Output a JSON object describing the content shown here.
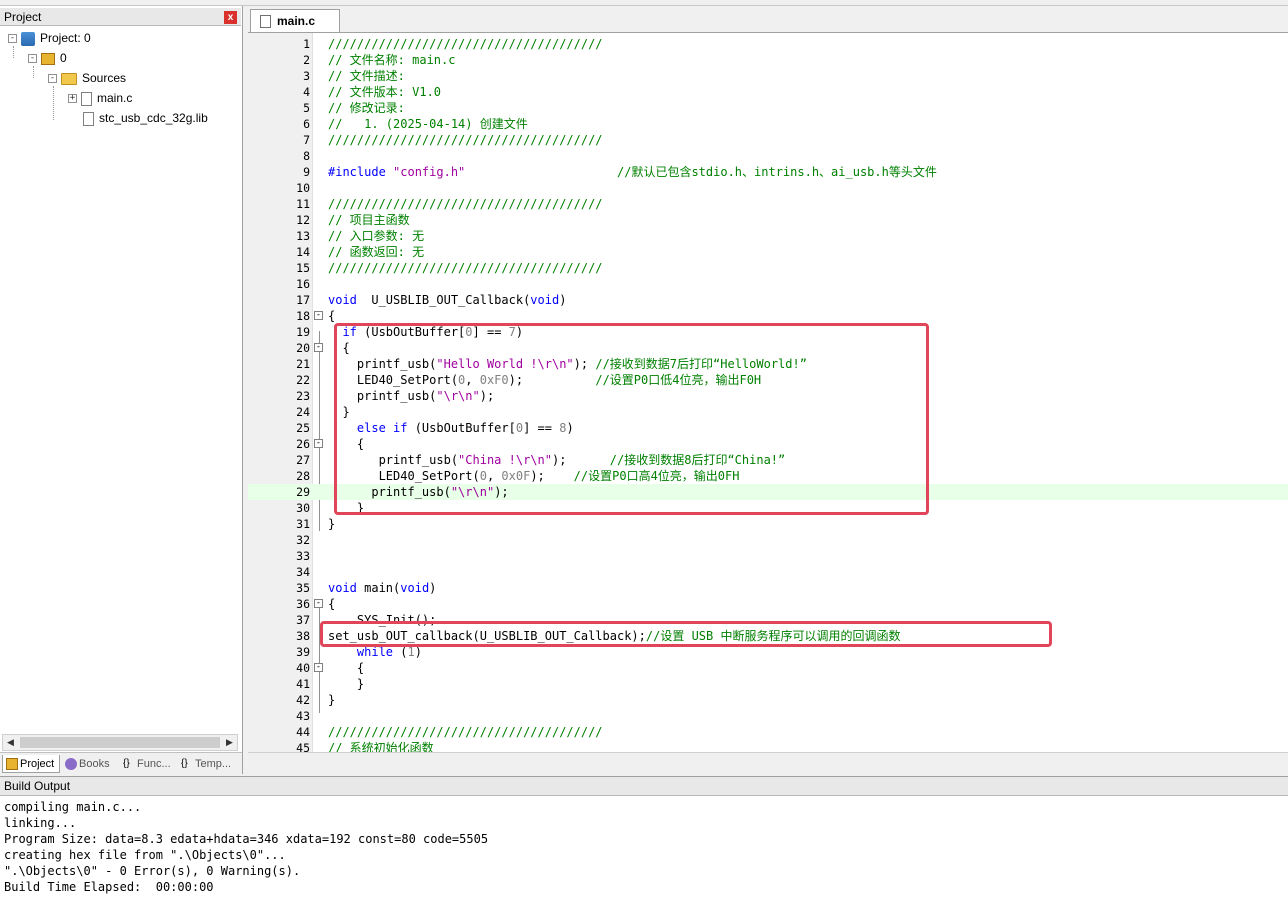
{
  "project_panel": {
    "title": "Project",
    "pin_glyph": "\u0004",
    "close_glyph": "x",
    "tree": {
      "root": "Project: 0",
      "target": "0",
      "group": "Sources",
      "files": [
        "main.c",
        "stc_usb_cdc_32g.lib"
      ]
    },
    "tabs": [
      "Project",
      "Books",
      "Func...",
      "Temp..."
    ]
  },
  "editor": {
    "tab_label": "main.c",
    "lines": [
      {
        "n": "1",
        "parts": [
          [
            "c",
            "//////////////////////////////////////"
          ]
        ]
      },
      {
        "n": "2",
        "parts": [
          [
            "c",
            "// 文件名称: main.c"
          ]
        ]
      },
      {
        "n": "3",
        "parts": [
          [
            "c",
            "// 文件描述:"
          ]
        ]
      },
      {
        "n": "4",
        "parts": [
          [
            "c",
            "// 文件版本: V1.0"
          ]
        ]
      },
      {
        "n": "5",
        "parts": [
          [
            "c",
            "// 修改记录:"
          ]
        ]
      },
      {
        "n": "6",
        "parts": [
          [
            "c",
            "//   1. (2025-04-14) 创建文件"
          ]
        ]
      },
      {
        "n": "7",
        "parts": [
          [
            "c",
            "//////////////////////////////////////"
          ]
        ]
      },
      {
        "n": "8",
        "parts": []
      },
      {
        "n": "9",
        "parts": [
          [
            "k",
            "#include "
          ],
          [
            "s",
            "\"config.h\""
          ],
          [
            "p",
            "                     "
          ],
          [
            "c",
            "//默认已包含stdio.h、intrins.h、ai_usb.h等头文件"
          ]
        ]
      },
      {
        "n": "10",
        "parts": []
      },
      {
        "n": "11",
        "parts": [
          [
            "c",
            "//////////////////////////////////////"
          ]
        ]
      },
      {
        "n": "12",
        "parts": [
          [
            "c",
            "// 项目主函数"
          ]
        ]
      },
      {
        "n": "13",
        "parts": [
          [
            "c",
            "// 入口参数: 无"
          ]
        ]
      },
      {
        "n": "14",
        "parts": [
          [
            "c",
            "// 函数返回: 无"
          ]
        ]
      },
      {
        "n": "15",
        "parts": [
          [
            "c",
            "//////////////////////////////////////"
          ]
        ]
      },
      {
        "n": "16",
        "parts": []
      },
      {
        "n": "17",
        "parts": [
          [
            "k",
            "void"
          ],
          [
            "p",
            "  U_USBLIB_OUT_Callback("
          ],
          [
            "k",
            "void"
          ],
          [
            "p",
            ")"
          ]
        ]
      },
      {
        "n": "18",
        "parts": [
          [
            "p",
            "{"
          ]
        ],
        "fold": "-"
      },
      {
        "n": "19",
        "parts": [
          [
            "p",
            "  "
          ],
          [
            "k",
            "if"
          ],
          [
            "p",
            " (UsbOutBuffer["
          ],
          [
            "n",
            "0"
          ],
          [
            "p",
            "] == "
          ],
          [
            "n",
            "7"
          ],
          [
            "p",
            ")"
          ]
        ]
      },
      {
        "n": "20",
        "parts": [
          [
            "p",
            "  {"
          ]
        ],
        "fold": "-"
      },
      {
        "n": "21",
        "parts": [
          [
            "p",
            "    printf_usb("
          ],
          [
            "s",
            "\"Hello World !\\r\\n\""
          ],
          [
            "p",
            "); "
          ],
          [
            "c",
            "//接收到数据7后打印“HelloWorld!”"
          ]
        ]
      },
      {
        "n": "22",
        "parts": [
          [
            "p",
            "    LED40_SetPort("
          ],
          [
            "n",
            "0"
          ],
          [
            "p",
            ", "
          ],
          [
            "n",
            "0xF0"
          ],
          [
            "p",
            ");          "
          ],
          [
            "c",
            "//设置P0口低4位亮，输出F0H"
          ]
        ]
      },
      {
        "n": "23",
        "parts": [
          [
            "p",
            "    printf_usb("
          ],
          [
            "s",
            "\"\\r\\n\""
          ],
          [
            "p",
            ");"
          ]
        ]
      },
      {
        "n": "24",
        "parts": [
          [
            "p",
            "  }"
          ]
        ]
      },
      {
        "n": "25",
        "parts": [
          [
            "p",
            "    "
          ],
          [
            "k",
            "else if"
          ],
          [
            "p",
            " (UsbOutBuffer["
          ],
          [
            "n",
            "0"
          ],
          [
            "p",
            "] == "
          ],
          [
            "n",
            "8"
          ],
          [
            "p",
            ")"
          ]
        ]
      },
      {
        "n": "26",
        "parts": [
          [
            "p",
            "    {"
          ]
        ],
        "fold": "-"
      },
      {
        "n": "27",
        "parts": [
          [
            "p",
            "       printf_usb("
          ],
          [
            "s",
            "\"China !\\r\\n\""
          ],
          [
            "p",
            ");      "
          ],
          [
            "c",
            "//接收到数据8后打印“China!”"
          ]
        ]
      },
      {
        "n": "28",
        "parts": [
          [
            "p",
            "       LED40_SetPort("
          ],
          [
            "n",
            "0"
          ],
          [
            "p",
            ", "
          ],
          [
            "n",
            "0x0F"
          ],
          [
            "p",
            ");    "
          ],
          [
            "c",
            "//设置P0口高4位亮，输出0FH"
          ]
        ]
      },
      {
        "n": "29",
        "parts": [
          [
            "p",
            "      printf_usb("
          ],
          [
            "s",
            "\"\\r\\n\""
          ],
          [
            "p",
            ");"
          ]
        ],
        "highlight": true
      },
      {
        "n": "30",
        "parts": [
          [
            "p",
            "    }"
          ]
        ]
      },
      {
        "n": "31",
        "parts": [
          [
            "p",
            "}"
          ]
        ]
      },
      {
        "n": "32",
        "parts": []
      },
      {
        "n": "33",
        "parts": []
      },
      {
        "n": "34",
        "parts": []
      },
      {
        "n": "35",
        "parts": [
          [
            "k",
            "void"
          ],
          [
            "p",
            " main("
          ],
          [
            "k",
            "void"
          ],
          [
            "p",
            ")"
          ]
        ]
      },
      {
        "n": "36",
        "parts": [
          [
            "p",
            "{"
          ]
        ],
        "fold": "-"
      },
      {
        "n": "37",
        "parts": [
          [
            "p",
            "    SYS_Init();"
          ]
        ]
      },
      {
        "n": "38",
        "parts": [
          [
            "p",
            "set_usb_OUT_callback(U_USBLIB_OUT_Callback);"
          ],
          [
            "c",
            "//设置 USB 中断服务程序可以调用的回调函数"
          ]
        ]
      },
      {
        "n": "39",
        "parts": [
          [
            "p",
            "    "
          ],
          [
            "k",
            "while"
          ],
          [
            "p",
            " ("
          ],
          [
            "n",
            "1"
          ],
          [
            "p",
            ")"
          ]
        ]
      },
      {
        "n": "40",
        "parts": [
          [
            "p",
            "    {"
          ]
        ],
        "fold": "-"
      },
      {
        "n": "41",
        "parts": [
          [
            "p",
            "    }"
          ]
        ]
      },
      {
        "n": "42",
        "parts": [
          [
            "p",
            "}"
          ]
        ]
      },
      {
        "n": "43",
        "parts": []
      },
      {
        "n": "44",
        "parts": [
          [
            "c",
            "//////////////////////////////////////"
          ]
        ]
      },
      {
        "n": "45",
        "parts": [
          [
            "c",
            "// 系统初始化函数"
          ]
        ]
      }
    ]
  },
  "build_output": {
    "title": "Build Output",
    "lines": [
      "compiling main.c...",
      "linking...",
      "Program Size: data=8.3 edata+hdata=346 xdata=192 const=80 code=5505",
      "creating hex file from \".\\Objects\\0\"...",
      "\".\\Objects\\0\" - 0 Error(s), 0 Warning(s).",
      "Build Time Elapsed:  00:00:00"
    ]
  },
  "colors": {
    "comment": "#008000",
    "keyword": "#0000ff",
    "string": "#a000a0",
    "number": "#808080",
    "annotation_box": "#e0455a",
    "current_line": "#e8ffe8"
  }
}
